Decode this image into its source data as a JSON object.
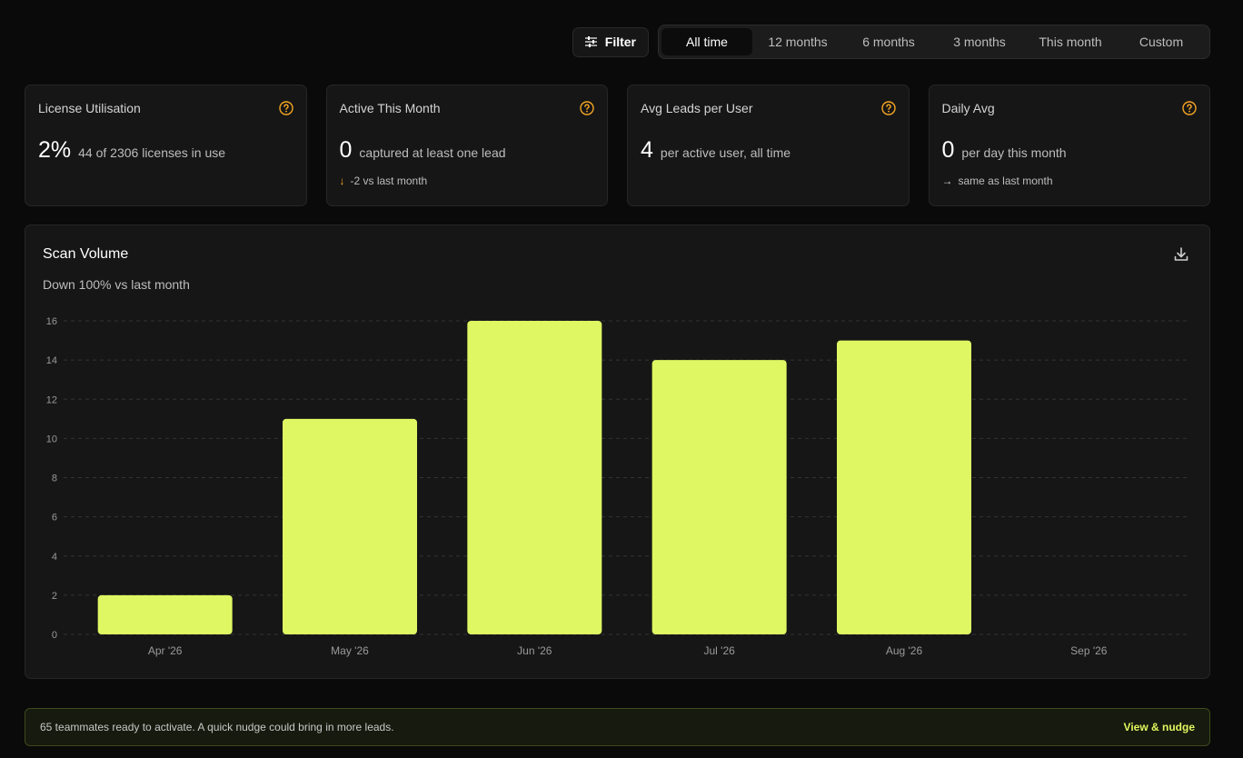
{
  "toolbar": {
    "filter_label": "Filter",
    "ranges": [
      "All time",
      "12 months",
      "6 months",
      "3 months",
      "This month",
      "Custom"
    ],
    "active_range": "All time"
  },
  "cards": [
    {
      "title": "License Utilisation",
      "value": "2%",
      "desc": "44 of 2306 licenses in use",
      "delta": ""
    },
    {
      "title": "Active This Month",
      "value": "0",
      "desc": "captured at least one lead",
      "delta": "-2 vs last month",
      "delta_icon": "arrow-down-icon"
    },
    {
      "title": "Avg Leads per User",
      "value": "4",
      "desc": "per active user, all time",
      "delta": ""
    },
    {
      "title": "Daily Avg",
      "value": "0",
      "desc": "per day this month",
      "delta": "same as last month",
      "delta_icon": "arrow-right-icon"
    }
  ],
  "chart": {
    "title": "Scan Volume",
    "subtitle": "Down 100% vs last month"
  },
  "chart_data": {
    "type": "bar",
    "categories": [
      "Apr '26",
      "May '26",
      "Jun '26",
      "Jul '26",
      "Aug '26",
      "Sep '26"
    ],
    "values": [
      2,
      11,
      16,
      14,
      15,
      0
    ],
    "ylim": [
      0,
      16
    ],
    "yticks": [
      0,
      2,
      4,
      6,
      8,
      10,
      12,
      14,
      16
    ],
    "grid": true,
    "bar_color": "#dff763"
  },
  "banner": {
    "text": "65 teammates ready to activate. A quick nudge could bring in more leads.",
    "link": "View & nudge"
  },
  "colors": {
    "accent": "#dff763",
    "warning": "#f5a623"
  }
}
